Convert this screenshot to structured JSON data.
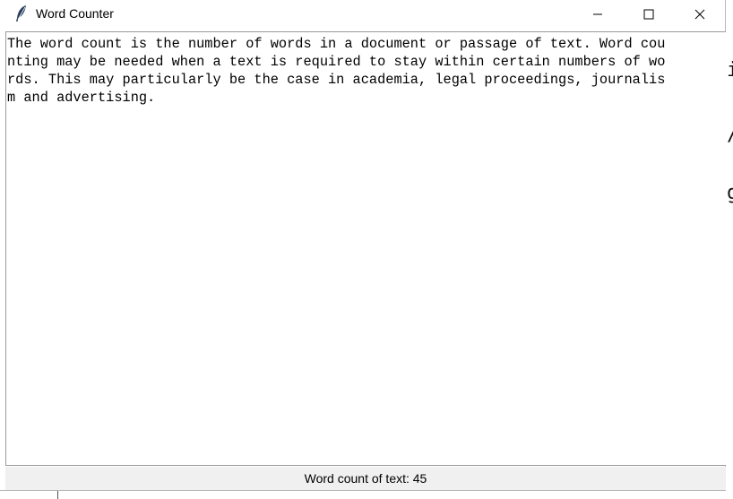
{
  "window": {
    "title": "Word Counter",
    "icon": "feather-icon",
    "controls": {
      "minimize_icon": "minimize-icon",
      "maximize_icon": "maximize-icon",
      "close_icon": "close-icon"
    }
  },
  "editor": {
    "lines": [
      "The word count is the number of words in a document or passage of text. Word cou",
      "nting may be needed when a text is required to stay within certain numbers of wo",
      "rds. This may particularly be the case in academia, legal proceedings, journalis",
      "m and advertising."
    ]
  },
  "status": {
    "text": "Word count of text: 45"
  },
  "background": {
    "glyphs": [
      "i",
      "/",
      "g"
    ]
  }
}
